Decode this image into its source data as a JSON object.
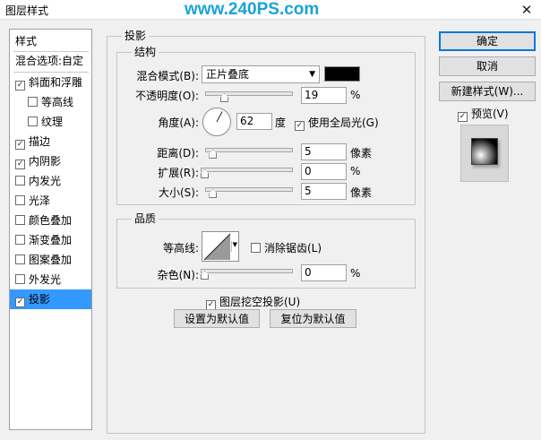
{
  "window": {
    "title": "图层样式",
    "watermark": "www.240PS.com",
    "close_glyph": "✕"
  },
  "sidebar": {
    "header": "样式",
    "blend_options": "混合选项:自定",
    "items": [
      {
        "label": "斜面和浮雕",
        "checked": true,
        "indent": false
      },
      {
        "label": "等高线",
        "checked": false,
        "indent": true
      },
      {
        "label": "纹理",
        "checked": false,
        "indent": true
      },
      {
        "label": "描边",
        "checked": true,
        "indent": false
      },
      {
        "label": "内阴影",
        "checked": true,
        "indent": false
      },
      {
        "label": "内发光",
        "checked": false,
        "indent": false
      },
      {
        "label": "光泽",
        "checked": false,
        "indent": false
      },
      {
        "label": "颜色叠加",
        "checked": false,
        "indent": false
      },
      {
        "label": "渐变叠加",
        "checked": false,
        "indent": false
      },
      {
        "label": "图案叠加",
        "checked": false,
        "indent": false
      },
      {
        "label": "外发光",
        "checked": false,
        "indent": false
      },
      {
        "label": "投影",
        "checked": true,
        "indent": false,
        "selected": true
      }
    ]
  },
  "panel": {
    "title": "投影",
    "structure": {
      "title": "结构",
      "blend_mode_label": "混合模式(B):",
      "blend_mode_value": "正片叠底",
      "blend_color": "#000000",
      "opacity_label": "不透明度(O):",
      "opacity_value": "19",
      "opacity_unit": "%",
      "angle_label": "角度(A):",
      "angle_value": "62",
      "angle_unit": "度",
      "global_light_label": "使用全局光(G)",
      "global_light_checked": true,
      "distance_label": "距离(D):",
      "distance_value": "5",
      "distance_unit": "像素",
      "spread_label": "扩展(R):",
      "spread_value": "0",
      "spread_unit": "%",
      "size_label": "大小(S):",
      "size_value": "5",
      "size_unit": "像素"
    },
    "quality": {
      "title": "品质",
      "contour_label": "等高线:",
      "antialias_label": "消除锯齿(L)",
      "antialias_checked": false,
      "noise_label": "杂色(N):",
      "noise_value": "0",
      "noise_unit": "%"
    },
    "knockout_label": "图层挖空投影(U)",
    "knockout_checked": true,
    "make_default": "设置为默认值",
    "reset_default": "复位为默认值"
  },
  "buttons": {
    "ok": "确定",
    "cancel": "取消",
    "new_style": "新建样式(W)...",
    "preview_label": "预览(V)",
    "preview_checked": true
  },
  "check_glyph": "✓"
}
